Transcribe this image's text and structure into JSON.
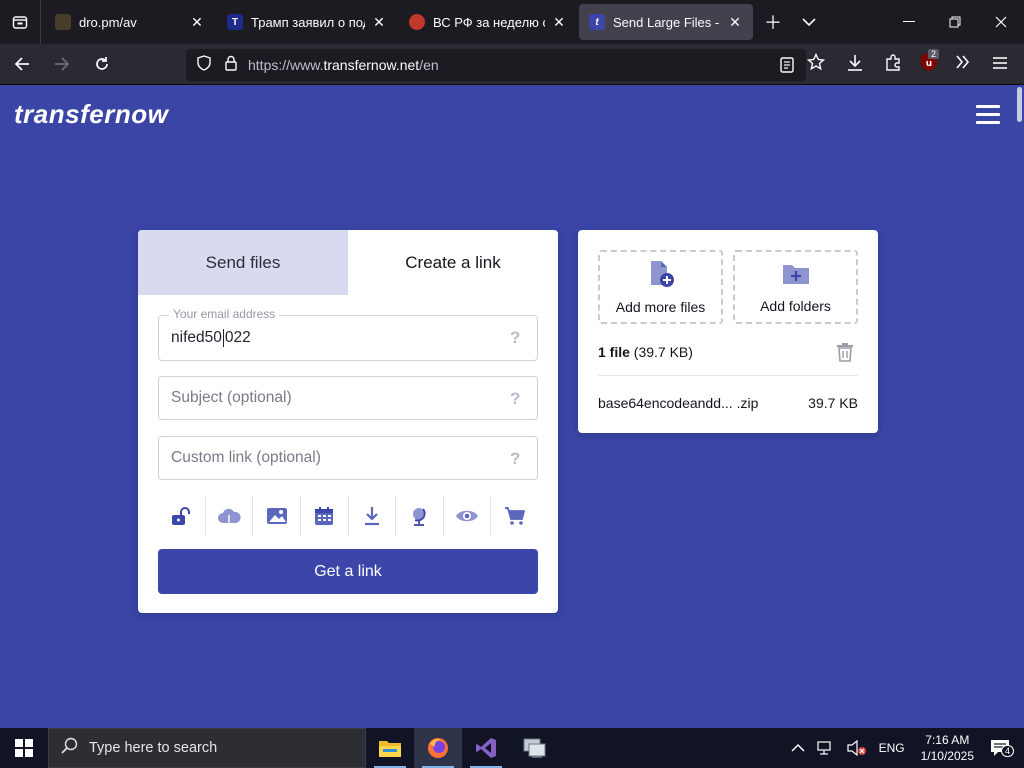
{
  "browser": {
    "tabs": [
      {
        "title": "dro.pm/av",
        "favicon_color": "#4a3c2a",
        "favicon_text": "",
        "active": false
      },
      {
        "title": "Трамп заявил о подгот",
        "favicon_color": "#1e2a8a",
        "favicon_text": "T",
        "active": false
      },
      {
        "title": "ВС РФ за неделю осво",
        "favicon_color": "#c0392b",
        "favicon_text": "",
        "active": false
      },
      {
        "title": "Send Large Files - Free",
        "favicon_color": "#3b46a8",
        "favicon_text": "t",
        "active": true
      }
    ],
    "url_prefix": "https://www.",
    "url_domain": "transfernow.net",
    "url_path": "/en",
    "extension_badge": "2"
  },
  "page": {
    "logo": "transfernow",
    "tabs": {
      "send": "Send files",
      "link": "Create a link"
    },
    "email": {
      "legend": "Your email address",
      "value_before_caret": "nifed50",
      "value_after_caret": "022",
      "help": "?"
    },
    "subject": {
      "placeholder": "Subject (optional)",
      "help": "?"
    },
    "custom_link": {
      "placeholder": "Custom link (optional)",
      "help": "?"
    },
    "options": [
      "lock-icon",
      "cloud-icon",
      "image-icon",
      "calendar-icon",
      "download-icon",
      "globe-icon",
      "eye-icon",
      "cart-icon"
    ],
    "get_link_label": "Get a link",
    "add_files_label": "Add more files",
    "add_folders_label": "Add folders",
    "file_count_bold": "1 file",
    "file_count_rest": " (39.7 KB)",
    "files": [
      {
        "name": "base64encodeandd... .zip",
        "size": "39.7 KB"
      }
    ]
  },
  "taskbar": {
    "search_placeholder": "Type here to search",
    "lang": "ENG",
    "time": "7:16 AM",
    "date": "1/10/2025",
    "notif_count": "4"
  },
  "colors": {
    "brand": "#3a45a6",
    "button": "#3b46a8",
    "icon": "#5b66bd"
  }
}
